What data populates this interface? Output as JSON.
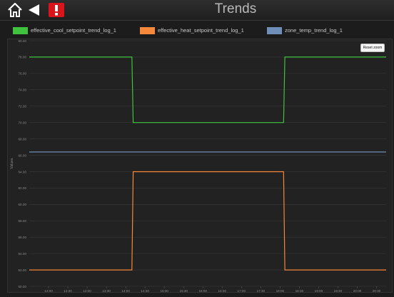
{
  "header": {
    "title": "Trends"
  },
  "icons": {
    "home": "home-icon",
    "back": "back-arrow-icon",
    "alert": "alert-icon"
  },
  "toolbar": {
    "reset_label": "Reset zoom"
  },
  "colors": {
    "cool": "#3fc33f",
    "heat": "#f5883a",
    "zone": "#6f8fb8",
    "alert_bg": "#d9141a",
    "background": "#1c1c1c"
  },
  "chart_data": {
    "type": "line",
    "ylabel": "Values",
    "xlabel": "",
    "grid": true,
    "legend_position": "top",
    "ylim": [
      50.0,
      80.0
    ],
    "y_ticks": [
      "80.00",
      "78.00",
      "76.00",
      "74.00",
      "72.00",
      "70.00",
      "68.00",
      "66.00",
      "64.00",
      "62.00",
      "60.00",
      "58.00",
      "56.00",
      "54.00",
      "52.00",
      "50.00"
    ],
    "x_ticks": [
      "12:00",
      "12:30",
      "13:00",
      "13:30",
      "14:00",
      "14:30",
      "15:00",
      "15:30",
      "16:00",
      "16:30",
      "17:00",
      "17:30",
      "18:00",
      "18:30",
      "19:00",
      "19:30",
      "20:00",
      "20:30"
    ],
    "series": [
      {
        "name": "effective_cool_setpoint_trend_log_1",
        "color": "#3fc33f",
        "x": [
          0,
          11.5,
          11.65,
          28.5,
          28.65,
          40
        ],
        "y": [
          78,
          78,
          70,
          70,
          78,
          78
        ]
      },
      {
        "name": "effective_heat_setpoint_trend_log_1",
        "color": "#f5883a",
        "x": [
          0,
          11.5,
          11.65,
          28.5,
          28.65,
          40
        ],
        "y": [
          52,
          52,
          64,
          64,
          52,
          52
        ]
      },
      {
        "name": "zone_temp_trend_log_1",
        "color": "#6f8fb8",
        "x": [
          0,
          40
        ],
        "y": [
          66.4,
          66.4
        ]
      }
    ]
  }
}
